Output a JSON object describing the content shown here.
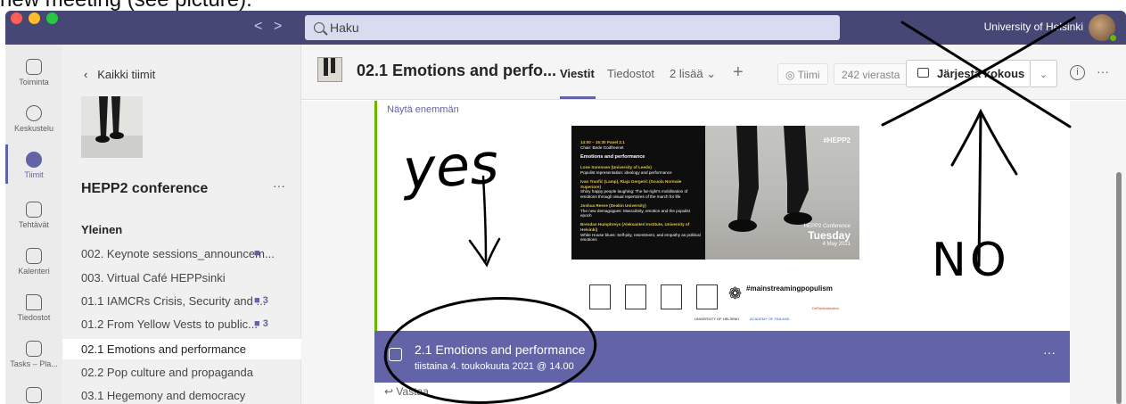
{
  "caption": "new meeting (see picture).",
  "titlebar": {
    "search_placeholder": "Haku",
    "organization": "University of Helsinki",
    "back_arrow": "<",
    "forward_arrow": ">"
  },
  "rail": {
    "items": [
      {
        "label": "Toiminta",
        "icon": "bell-icon"
      },
      {
        "label": "Keskustelu",
        "icon": "chat-icon"
      },
      {
        "label": "Tiimit",
        "icon": "teams-icon",
        "active": true
      },
      {
        "label": "Tehtävät",
        "icon": "assignments-icon"
      },
      {
        "label": "Kalenteri",
        "icon": "calendar-icon"
      },
      {
        "label": "Tiedostot",
        "icon": "files-icon"
      },
      {
        "label": "Tasks – Pla...",
        "icon": "tasks-icon"
      }
    ]
  },
  "sidebar": {
    "back_label": "Kaikki tiimit",
    "team_name": "HEPP2 conference",
    "team_more": "···",
    "channel_group": "Yleinen",
    "channels": [
      {
        "label": "002. Keynote sessions_announcem...",
        "badge": ""
      },
      {
        "label": "003. Virtual Café HEPPsinki",
        "badge": ""
      },
      {
        "label": "01.1 IAMCRs Crisis, Security and ...",
        "badge": "3"
      },
      {
        "label": "01.2 From Yellow Vests to public...",
        "badge": "3"
      },
      {
        "label": "02.1 Emotions and performance",
        "badge": "",
        "selected": true
      },
      {
        "label": "02.2 Pop culture and propaganda",
        "badge": ""
      },
      {
        "label": "03.1 Hegemony and democracy",
        "badge": ""
      }
    ]
  },
  "header": {
    "channel_title": "02.1 Emotions and perfo...",
    "tabs": [
      "Viestit",
      "Tiedostot",
      "2 lisää"
    ],
    "add_tab": "+",
    "team_button": "Tiimi",
    "guests": "242 vierasta",
    "meet_button": "Järjestä kokous",
    "meet_dropdown": "⌄",
    "info": "i",
    "more": "···"
  },
  "post": {
    "show_more": "Näytä enemmän",
    "poster": {
      "time_line": "14:00 – 15:30 Panel 2.1",
      "chair": "Chair: Bede Godfreenet",
      "heading": "Emotions and performance",
      "talks": [
        {
          "author": "Lone Sorensen (University of Leeds)",
          "title": "Populist representation: ideology and performance"
        },
        {
          "author": "Ivan Tranfić (Lamp), Riaja Gergerić (Scuola Normale Superiore)",
          "title": "Shiny happy people laughing: The far-right's mobilisation of emotions through visual repertoires of the march for life"
        },
        {
          "author": "Joshua Reeve (Deakin University)",
          "title": "The new demagogues: Masculinity, emotion and the populist epoch"
        },
        {
          "author": "Brendan Humphreys (Aleksanteri Institute, University of Helsinki)",
          "title": "White House blues: Self-pity, resentment, and empathy as political emotions"
        }
      ],
      "hashtag": "#HEPP2",
      "conf_name": "HEPP2 Conference",
      "day": "Tuesday",
      "date": "4 May 2021",
      "mainstreaming": "#mainstreamingpopulism",
      "logos": [
        "UNIVERSITY OF HELSINKI",
        "ACADEMY OF FINLAND",
        "DeRadicalisation"
      ]
    },
    "event_title": "2.1 Emotions and performance",
    "event_date": "tiistaina 4. toukokuuta 2021 @ 14.00",
    "event_more": "···",
    "reply": "Vastaa"
  },
  "annotations": {
    "yes": "yes",
    "no": "NO"
  }
}
